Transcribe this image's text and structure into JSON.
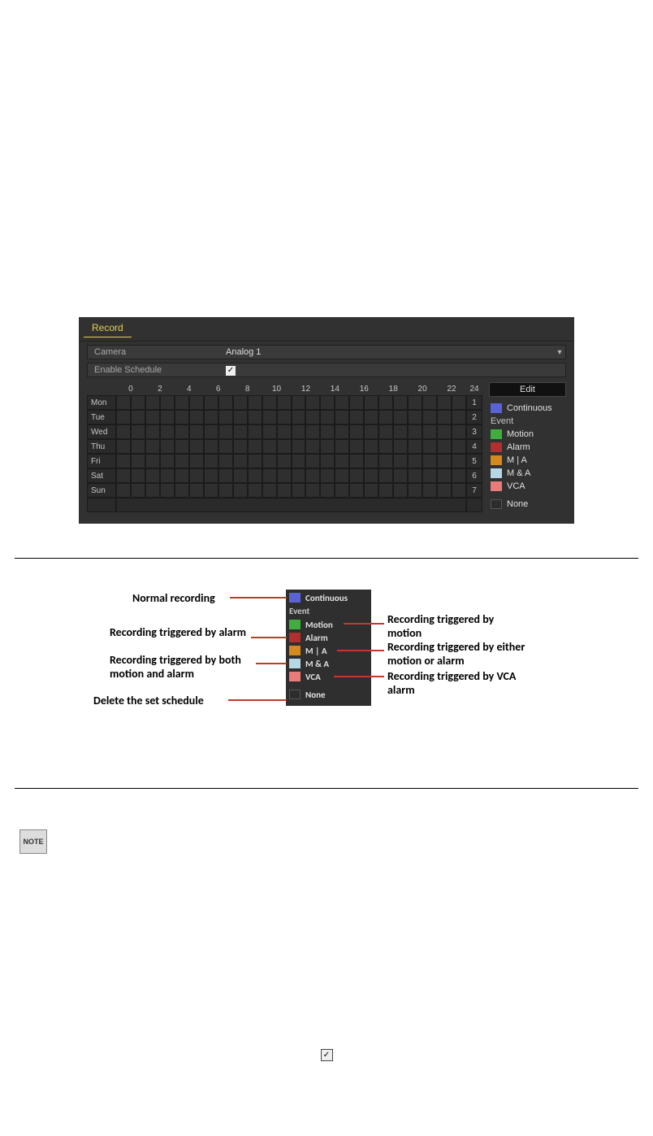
{
  "record": {
    "title": "Record",
    "camera_label": "Camera",
    "camera_value": "Analog 1",
    "enable_label": "Enable Schedule",
    "enable_checked": true,
    "hours": [
      "0",
      "2",
      "4",
      "6",
      "8",
      "10",
      "12",
      "14",
      "16",
      "18",
      "20",
      "22",
      "24"
    ],
    "days": [
      "Mon",
      "Tue",
      "Wed",
      "Thu",
      "Fri",
      "Sat",
      "Sun"
    ],
    "row_nums": [
      "1",
      "2",
      "3",
      "4",
      "5",
      "6",
      "7"
    ],
    "edit_btn": "Edit"
  },
  "legend": {
    "continuous": "Continuous",
    "event_header": "Event",
    "items": [
      {
        "label": "Motion",
        "color": "#3fae3f"
      },
      {
        "label": "Alarm",
        "color": "#b03030"
      },
      {
        "label": "M | A",
        "color": "#d68a1e"
      },
      {
        "label": "M & A",
        "color": "#b6d8e6"
      },
      {
        "label": "VCA",
        "color": "#e97b7b"
      }
    ],
    "none": "None",
    "continuous_color": "#5a63d6"
  },
  "anno": {
    "normal": "Normal recording",
    "motion": "Recording triggered by motion",
    "alarm": "Recording triggered by alarm",
    "mora": "Recording triggered by either motion or alarm",
    "manda": "Recording triggered by both motion and alarm",
    "vca": "Recording triggered by VCA alarm",
    "delete": "Delete the set schedule"
  },
  "note_icon_text": "NOTE"
}
